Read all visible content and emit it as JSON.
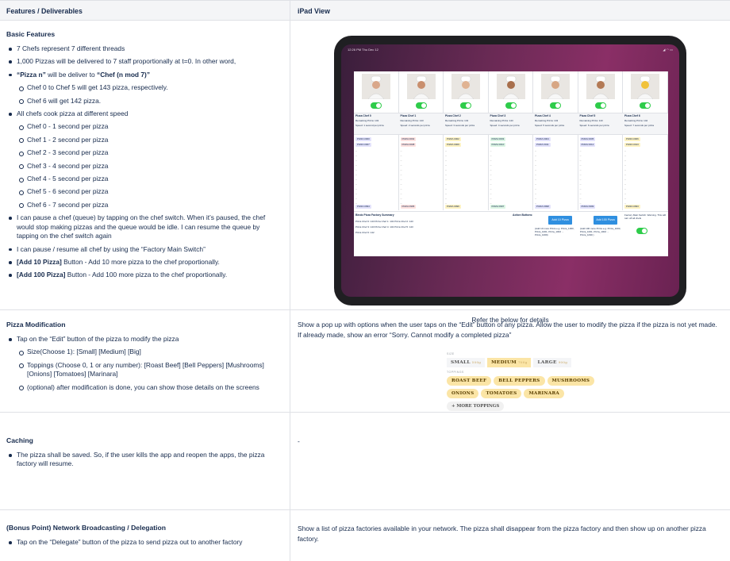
{
  "header": {
    "col1": "Features / Deliverables",
    "col2": "iPad View"
  },
  "basic": {
    "title": "Basic Features",
    "bullets": {
      "b1": "7 Chefs represent 7 different threads",
      "b2": "1,000 Pizzas will be delivered to 7 staff proportionally at t=0. In other word,",
      "b3_bold1": "“Pizza n”",
      "b3_mid": " will be deliver to ",
      "b3_bold2": "“Chef (n mod 7)”",
      "b3_sub1": "Chef 0 to Chef 5 will get 143 pizza, respectively.",
      "b3_sub2": "Chef 6 will get 142 pizza.",
      "b4": "All chefs cook pizza at different speed",
      "speeds": [
        "Chef 0 - 1 second per pizza",
        "Chef 1 - 2 second per pizza",
        "Chef 2 - 3 second per pizza",
        "Chef 3 - 4 second per pizza",
        "Chef 4 - 5 second per pizza",
        "Chef 5 - 6 second per pizza",
        "Chef 6 - 7 second per pizza"
      ],
      "b5": "I can pause a chef (queue) by tapping on the chef switch. When it’s paused, the chef would stop making pizzas and the queue would be idle. I can resume the queue by tapping on the chef switch again",
      "b6": "I can pause / resume all chef by using the “Factory Main Switch”",
      "b7_bold": "[Add 10 Pizza]",
      "b7_rest": " Button - Add 10 more pizza to the chef proportionally.",
      "b8_bold": "[Add 100 Pizza]",
      "b8_rest": " Button - Add 100 more pizza to the chef proportionally."
    },
    "caption": "Refer the below for details"
  },
  "ipad": {
    "status_time": "12:26 PM   Thu Dec 12",
    "status_icons": "◢ ◠ ▭",
    "chefs": [
      {
        "name": "Pizza Chef 0",
        "remaining": "Remaining Pizza: 143",
        "speed": "Speed: 1 second per pizza",
        "t1": "PIZZA 0000",
        "t2": "PIZZA 0007",
        "last": "PIZZA 0994",
        "color": "#e3e2fb"
      },
      {
        "name": "Pizza Chef 1",
        "remaining": "Remaining Pizza: 143",
        "speed": "Speed: 2 seconds per pizza",
        "t1": "PIZZA 0002",
        "t2": "PIZZA 0008",
        "last": "PIZZA 0995",
        "color": "#fde2e0"
      },
      {
        "name": "Pizza Chef 2",
        "remaining": "Remaining Pizza: 143",
        "speed": "Speed: 3 seconds per pizza",
        "t1": "PIZZA 0002",
        "t2": "PIZZA 0009",
        "last": "PIZZA 0996",
        "color": "#fdf2c2"
      },
      {
        "name": "Pizza Chef 3",
        "remaining": "Remaining Pizza: 143",
        "speed": "Speed: 4 seconds per pizza",
        "t1": "PIZZA 0003",
        "t2": "PIZZA 0010",
        "last": "PIZZA 0997",
        "color": "#dcf5e4"
      },
      {
        "name": "Pizza Chef 4",
        "remaining": "Remaining Pizza: 143",
        "speed": "Speed: 5 seconds per pizza",
        "t1": "PIZZA 0004",
        "t2": "PIZZA 0011",
        "last": "PIZZA 0998",
        "color": "#e3e2fb"
      },
      {
        "name": "Pizza Chef 5",
        "remaining": "Remaining Pizza: 143",
        "speed": "Speed: 6 seconds per pizza",
        "t1": "PIZZA 0005",
        "t2": "PIZZA 0012",
        "last": "PIZZA 0999",
        "color": "#e3e2fb"
      },
      {
        "name": "Pizza Chef 6",
        "remaining": "Remaining Pizza: 142",
        "speed": "Speed: 7 seconds per pizza",
        "t1": "PIZZA 0006",
        "t2": "PIZZA 0013",
        "last": "PIZZA 0993",
        "color": "#fdf2c2"
      }
    ],
    "dash": "--",
    "summary_title": "Bindo Pizza Factory Summary",
    "summary_lines": [
      "Pizza Chef 0: 143     Pizza Chef 1: 143     Pizza Chef 2: 143",
      "Pizza Chef 3: 143     Pizza Chef 4: 143     Pizza Chef 5: 143",
      "Pizza Chef 6: 142"
    ],
    "action_label": "Action Buttons:",
    "add10": "Add 10 Pizza",
    "add100": "Add 100 Pizza",
    "add10_desc": "(Add 10 more Pizza e.g. Pizza_1000, Pizza_1001, Pizza_1002 ... Pizza_1009)",
    "add100_desc": "(Add 100 more Pizza e.g. Pizza_1000, Pizza_1001, Pizza_1002 ... Pizza_1099 )",
    "main_switch": "Factory Main Switch. Warning. This will turn off all chefs"
  },
  "modification": {
    "title": "Pizza Modification",
    "b1": "Tap on the “Edit” button of the pizza to modify the pizza",
    "s1": "Size(Choose 1): [Small] [Medium] [Big]",
    "s2": "Toppings (Choose 0, 1 or any number): [Roast Beef] [Bell Peppers] [Mushrooms] [Onions] [Tomatoes] [Marinara]",
    "s3": "(optional) after modification is done, you can show those details on the screens",
    "right": "Show a pop up with options when the user taps on the “Edit” button of any pizza. Allow the user to modify the pizza if the pizza is not yet made. If already made, show an error “Sorry. Cannot modify a completed pizza”",
    "size_label": "SIZE",
    "sizes": [
      {
        "name": "SMALL",
        "w": "500g"
      },
      {
        "name": "MEDIUM",
        "w": "700g"
      },
      {
        "name": "LARGE",
        "w": "900g"
      }
    ],
    "toppings_label": "TOPPINGS",
    "toppings": [
      "ROAST BEEF",
      "BELL PEPPERS",
      "MUSHROOMS",
      "ONIONS",
      "TOMATOES",
      "MARINARA"
    ],
    "more": "+ MORE TOPPINGS"
  },
  "caching": {
    "title": "Caching",
    "b1": "The pizza shall be saved. So, if the user kills the app and reopen the apps, the pizza factory will resume.",
    "right": "-"
  },
  "network": {
    "title": "(Bonus Point) Network Broadcasting / Delegation",
    "b1": "Tap on the “Delegate” button of the pizza to send pizza out to another factory",
    "right": "Show a list of pizza factories available in your network. The pizza shall disappear from the pizza factory and then show up on another pizza factory."
  }
}
